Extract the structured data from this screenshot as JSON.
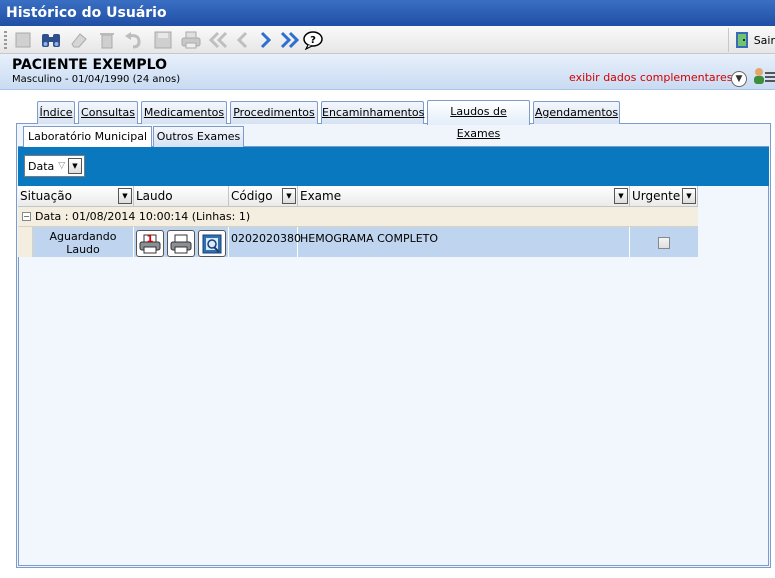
{
  "window": {
    "title": "Histórico do Usuário"
  },
  "toolbar": {
    "icons": [
      "new-icon",
      "binoculars-icon",
      "eraser-icon",
      "trash-icon",
      "undo-icon",
      "save-icon",
      "print-icon",
      "first-icon",
      "prev-icon",
      "next-icon",
      "last-icon",
      "help-icon"
    ],
    "exit_label": "Sair"
  },
  "patient": {
    "name": "PACIENTE EXEMPLO",
    "info": "Masculino - 01/04/1990 (24 anos)",
    "extra_link": "exibir dados complementares..."
  },
  "tabs": [
    {
      "label": "Índice"
    },
    {
      "label": "Consultas"
    },
    {
      "label": "Medicamentos"
    },
    {
      "label": "Procedimentos"
    },
    {
      "label": "Encaminhamentos"
    },
    {
      "label": "Laudos de Exames",
      "active": true
    },
    {
      "label": "Agendamentos"
    }
  ],
  "subtabs": [
    {
      "label": "Laboratório Municipal",
      "active": true
    },
    {
      "label": "Outros Exames"
    }
  ],
  "group_chip": {
    "label": "Data"
  },
  "grid": {
    "columns": [
      "Situação",
      "Laudo",
      "Código",
      "Exame",
      "Urgente"
    ],
    "group_row": "Data : 01/08/2014 10:00:14 (Linhas: 1)",
    "rows": [
      {
        "situacao": "Aguardando Laudo",
        "codigo": "0202020380",
        "exame": "HEMOGRAMA COMPLETO",
        "urgente": false,
        "print_badge": "1"
      }
    ]
  },
  "colors": {
    "title_bar": "#1f4fa5",
    "group_bar": "#0a78bf",
    "row_selected": "#bfd4ef",
    "link_red": "#d40000"
  }
}
